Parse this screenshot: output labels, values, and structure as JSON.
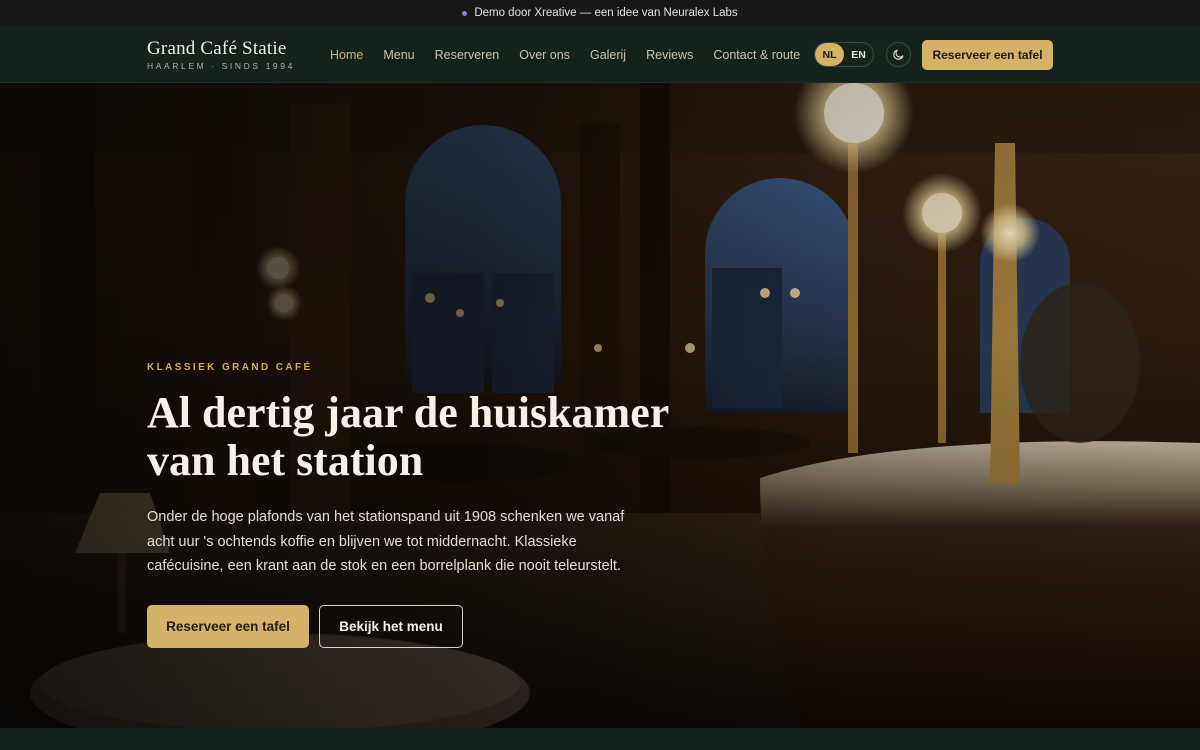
{
  "demo_bar": {
    "text": "Demo door Xreative — een idee van Neuralex Labs"
  },
  "brand": {
    "name": "Grand Café Statie",
    "tagline": "HAARLEM · SINDS 1994"
  },
  "nav": {
    "links": [
      "Home",
      "Menu",
      "Reserveren",
      "Over ons",
      "Galerij",
      "Reviews",
      "Contact & route"
    ],
    "active": "Home",
    "languages": [
      "NL",
      "EN"
    ],
    "active_language": "NL",
    "theme_toggle_icon": "moon-icon",
    "cta_label": "Reserveer een tafel"
  },
  "hero": {
    "eyebrow": "KLASSIEK GRAND CAFÉ",
    "headline": "Al dertig jaar de huiskamer van het station",
    "lead": "Onder de hoge plafonds van het stationspand uit 1908 schenken we vanaf acht uur 's ochtends koffie en blijven we tot middernacht. Klassieke cafécuisine, een krant aan de stok en een borrelplank die nooit teleurstelt.",
    "primary_button": "Reserveer een tafel",
    "secondary_button": "Bekijk het menu"
  },
  "colors": {
    "accent": "#d4b267",
    "nav_bg": "#14221b",
    "demo_bar_bg": "#171717",
    "demo_dot": "#8e7cf0"
  }
}
